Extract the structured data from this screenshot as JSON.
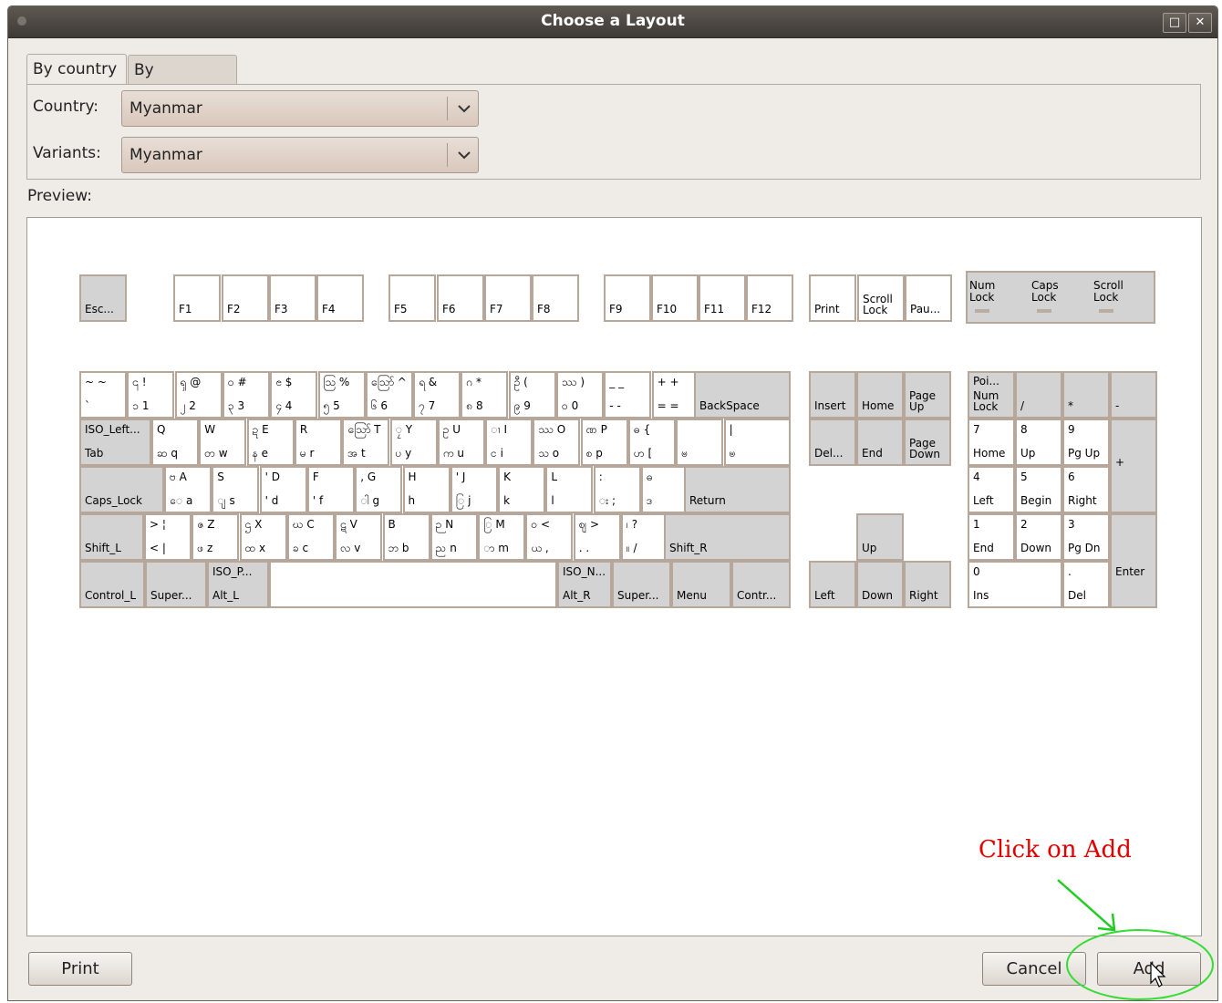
{
  "window": {
    "title": "Choose a Layout",
    "buttons": [
      "□",
      "✕"
    ]
  },
  "tabs": [
    {
      "label": "By country",
      "active": true
    },
    {
      "label": "By language",
      "active": false
    }
  ],
  "country": {
    "label": "Country:",
    "value": "Myanmar"
  },
  "variants": {
    "label": "Variants:",
    "value": "Myanmar"
  },
  "preview_label": "Preview:",
  "keyboard": {
    "function_row": [
      "Esc...",
      "F1",
      "F2",
      "F3",
      "F4",
      "F5",
      "F6",
      "F7",
      "F8",
      "F9",
      "F10",
      "F11",
      "F12",
      "Print",
      "Scroll Lock",
      "Pau..."
    ],
    "lock_indicators": [
      "Num Lock",
      "Caps Lock",
      "Scroll Lock"
    ],
    "row1": [
      {
        "tl": "~  ~",
        "bl": "`"
      },
      {
        "tl": "၎  !",
        "bl": "၁  1"
      },
      {
        "tl": "ၡ  @",
        "bl": "၂  2"
      },
      {
        "tl": "ဝ  #",
        "bl": "၃  3"
      },
      {
        "tl": "ၔ  $",
        "bl": "၄  4"
      },
      {
        "tl": "ဩ  %",
        "bl": "၅  5"
      },
      {
        "tl": "ဪ  ^",
        "bl": "၆  6"
      },
      {
        "tl": "ရ  &",
        "bl": "၇  7"
      },
      {
        "tl": "ဂ  *",
        "bl": "၈  8"
      },
      {
        "tl": "ဦ  (",
        "bl": "၉  9"
      },
      {
        "tl": "ဿ  )",
        "bl": "၀  0"
      },
      {
        "tl": "_  _",
        "bl": "-  -"
      },
      {
        "tl": "+  +",
        "bl": "=  ="
      },
      {
        "bl": "BackSpace"
      }
    ],
    "row2": [
      {
        "tl": "ISO_Left...",
        "bl": "Tab"
      },
      {
        "tl": "     Q",
        "bl": "ဆ  q"
      },
      {
        "tl": "     W",
        "bl": "တ  w"
      },
      {
        "tl": "ဍ  E",
        "bl": "န  e"
      },
      {
        "tl": "     R",
        "bl": "မ  r"
      },
      {
        "tl": "ဪ  T",
        "bl": "အ  t"
      },
      {
        "tl": "ၠ  Y",
        "bl": "ပ  y"
      },
      {
        "tl": "ဥ  U",
        "bl": "က  u"
      },
      {
        "tl": "ၢ  I",
        "bl": "င  i"
      },
      {
        "tl": "ဿ  O",
        "bl": "သ  o"
      },
      {
        "tl": "ဏ  P",
        "bl": "စ  p"
      },
      {
        "tl": "ဓ  {",
        "bl": "ဟ  ["
      },
      {
        "tl": "",
        "bl": "ၑ"
      },
      {
        "tl": "     |",
        "bl": "ၑ"
      }
    ],
    "row3": [
      {
        "bl": "Caps_Lock"
      },
      {
        "tl": "ဗ  A",
        "bl": "ေ  a"
      },
      {
        "tl": "     S",
        "bl": "ျ  s"
      },
      {
        "tl": "'   D",
        "bl": "'   d"
      },
      {
        "tl": "     F",
        "bl": "'   f"
      },
      {
        "tl": ",   G",
        "bl": "ါ  g"
      },
      {
        "tl": "     H",
        "bl": "   h"
      },
      {
        "tl": "'   J",
        "bl": "ြ  j"
      },
      {
        "tl": "     K",
        "bl": "   k"
      },
      {
        "tl": "     L",
        "bl": "   l"
      },
      {
        "tl": "     :",
        "bl": "း  ;"
      },
      {
        "tl": "ဓ",
        "bl": "ဒ"
      },
      {
        "bl": "Return"
      }
    ],
    "row4": [
      {
        "bl": "Shift_L"
      },
      {
        "tl": ">  ¦",
        "bl": "<  |"
      },
      {
        "tl": "ဇ  Z",
        "bl": "ဖ  z"
      },
      {
        "tl": "ဌ  X",
        "bl": "ထ  x"
      },
      {
        "tl": "ဃ  C",
        "bl": "ခ  c"
      },
      {
        "tl": "ဋ  V",
        "bl": "လ  v"
      },
      {
        "tl": "     B",
        "bl": "ဘ  b"
      },
      {
        "tl": "ဉ  N",
        "bl": "ည  n"
      },
      {
        "tl": "ြ  M",
        "bl": "ာ  m"
      },
      {
        "tl": "ဝ  <",
        "bl": "ယ  ,"
      },
      {
        "tl": "ဈ  >",
        "bl": ".   ."
      },
      {
        "tl": "၊  ?",
        "bl": "။  /"
      },
      {
        "bl": "Shift_R"
      }
    ],
    "row5": [
      {
        "bl": "Control_L"
      },
      {
        "bl": "Super..."
      },
      {
        "tl": "ISO_P...",
        "bl": "Alt_L"
      },
      {
        "bl": ""
      },
      {
        "tl": "ISO_N...",
        "bl": "Alt_R"
      },
      {
        "bl": "Super..."
      },
      {
        "bl": "Menu"
      },
      {
        "bl": "Contr..."
      }
    ],
    "nav": {
      "insert": "Insert",
      "home": "Home",
      "page_up": "Page Up",
      "delete": "Del...",
      "end": "End",
      "page_down": "Page Down",
      "up": "Up",
      "left": "Left",
      "down": "Down",
      "right": "Right"
    },
    "numpad": {
      "numlock_top": "Poi...",
      "numlock_bottom": "Num Lock",
      "div": "/",
      "mul": "*",
      "minus": "-",
      "plus": "+",
      "k7": [
        "7",
        "Home"
      ],
      "k8": [
        "8",
        "Up"
      ],
      "k9": [
        "9",
        "Pg Up"
      ],
      "k4": [
        "4",
        "Left"
      ],
      "k5": [
        "5",
        "Begin"
      ],
      "k6": [
        "6",
        "Right"
      ],
      "k1": [
        "1",
        "End"
      ],
      "k2": [
        "2",
        "Down"
      ],
      "k3": [
        "3",
        "Pg Dn"
      ],
      "k0": [
        "0",
        "Ins"
      ],
      "kdot": [
        ".",
        "Del"
      ],
      "enter": "Enter"
    }
  },
  "annotation": {
    "text": "Click on Add",
    "color": "#e00000",
    "arrow_color": "#22cc22"
  },
  "footer": {
    "print": "Print",
    "cancel": "Cancel",
    "add": "Add"
  }
}
